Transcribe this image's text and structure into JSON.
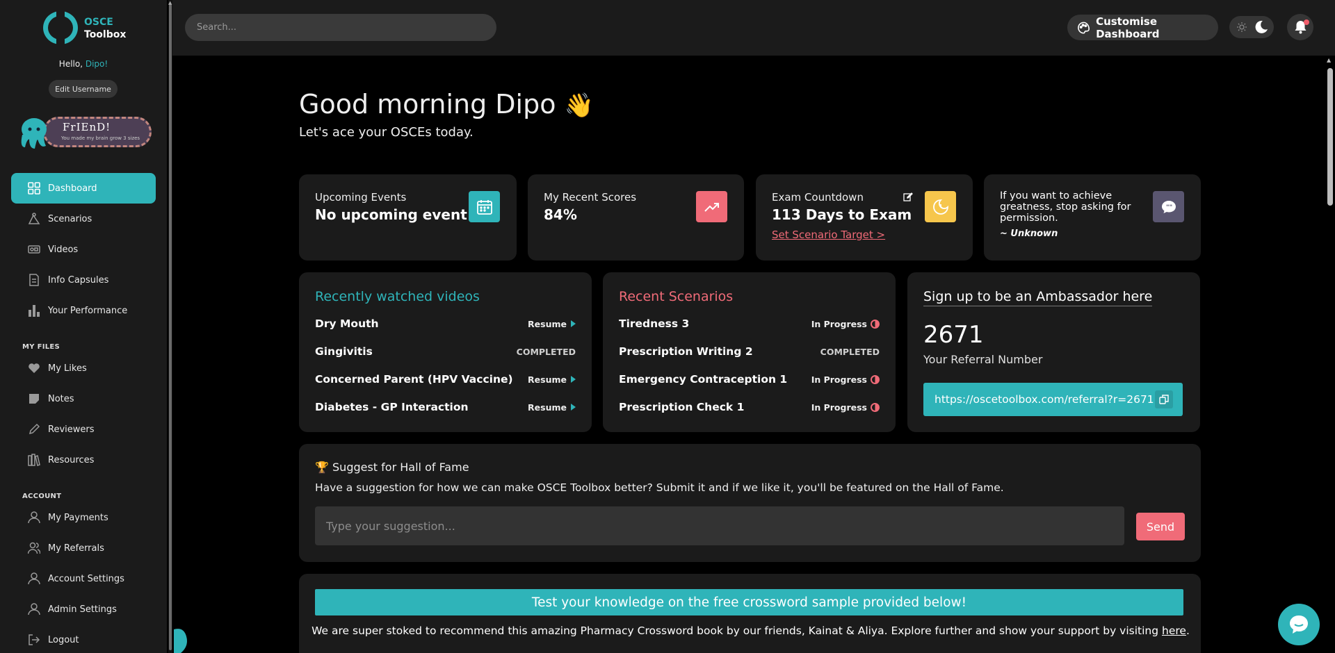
{
  "brand": {
    "line1": "OSCE",
    "line2": "Toolbox"
  },
  "user": {
    "greeting_prefix": "Hello, ",
    "name": "Dipo!",
    "edit_username": "Edit Username"
  },
  "badge": {
    "title": "FrIEnD!",
    "subtitle": "You made my brain grow 3 sizes"
  },
  "nav": {
    "main": [
      {
        "label": "Dashboard",
        "icon": "grid-icon",
        "active": true
      },
      {
        "label": "Scenarios",
        "icon": "scenario-icon"
      },
      {
        "label": "Videos",
        "icon": "video-icon"
      },
      {
        "label": "Info Capsules",
        "icon": "document-icon"
      },
      {
        "label": "Your Performance",
        "icon": "bar-chart-icon"
      }
    ],
    "files_label": "MY FILES",
    "files": [
      {
        "label": "My Likes",
        "icon": "heart-icon"
      },
      {
        "label": "Notes",
        "icon": "note-icon"
      },
      {
        "label": "Reviewers",
        "icon": "pencil-icon"
      },
      {
        "label": "Resources",
        "icon": "books-icon"
      }
    ],
    "account_label": "ACCOUNT",
    "account": [
      {
        "label": "My Payments",
        "icon": "user-icon"
      },
      {
        "label": "My Referrals",
        "icon": "users-icon"
      },
      {
        "label": "Account Settings",
        "icon": "user-icon"
      },
      {
        "label": "Admin Settings",
        "icon": "user-icon"
      },
      {
        "label": "Logout",
        "icon": "logout-icon"
      }
    ]
  },
  "topbar": {
    "search_placeholder": "Search...",
    "customise_label": "Customise Dashboard"
  },
  "greeting": {
    "title": "Good morning Dipo",
    "emoji": "👋",
    "subtitle": "Let's ace your OSCEs today."
  },
  "stats": {
    "events": {
      "label": "Upcoming Events",
      "value": "No upcoming event"
    },
    "scores": {
      "label": "My Recent Scores",
      "value": "84%"
    },
    "countdown": {
      "label": "Exam Countdown",
      "value": "113 Days to Exam",
      "link": "Set Scenario Target >"
    },
    "quote": {
      "text": "If you want to achieve greatness, stop asking for permission.",
      "author": "~ Unknown"
    }
  },
  "videos": {
    "title": "Recently watched videos",
    "items": [
      {
        "name": "Dry Mouth",
        "status": "Resume"
      },
      {
        "name": "Gingivitis",
        "status": "COMPLETED"
      },
      {
        "name": "Concerned Parent (HPV Vaccine)",
        "status": "Resume"
      },
      {
        "name": "Diabetes - GP Interaction",
        "status": "Resume"
      }
    ]
  },
  "scenarios": {
    "title": "Recent Scenarios",
    "items": [
      {
        "name": "Tiredness 3",
        "status": "In Progress"
      },
      {
        "name": "Prescription Writing 2",
        "status": "COMPLETED"
      },
      {
        "name": "Emergency Contraception 1",
        "status": "In Progress"
      },
      {
        "name": "Prescription Check 1",
        "status": "In Progress"
      }
    ]
  },
  "ambassador": {
    "title": "Sign up to be an Ambassador here",
    "referral_number": "2671",
    "referral_label": "Your Referral Number",
    "referral_url": "https://oscetoolbox.com/referral?r=2671"
  },
  "hall_of_fame": {
    "title": "Suggest for Hall of Fame",
    "description": "Have a suggestion for how we can make OSCE Toolbox better? Submit it and if we like it, you'll be featured on the Hall of Fame.",
    "placeholder": "Type your suggestion...",
    "send_label": "Send"
  },
  "crossword": {
    "banner": "Test your knowledge on the free crossword sample provided below!",
    "text": "We are super stoked to recommend this amazing Pharmacy Crossword book by our friends, Kainat & Aliya. Explore further and show your support by visiting ",
    "link": "here",
    "suffix": "."
  },
  "colors": {
    "accent": "#2fb4b9",
    "danger": "#f06b78",
    "warning": "#f6c64c",
    "sidebar": "#1b1b1b",
    "background": "#000000"
  }
}
